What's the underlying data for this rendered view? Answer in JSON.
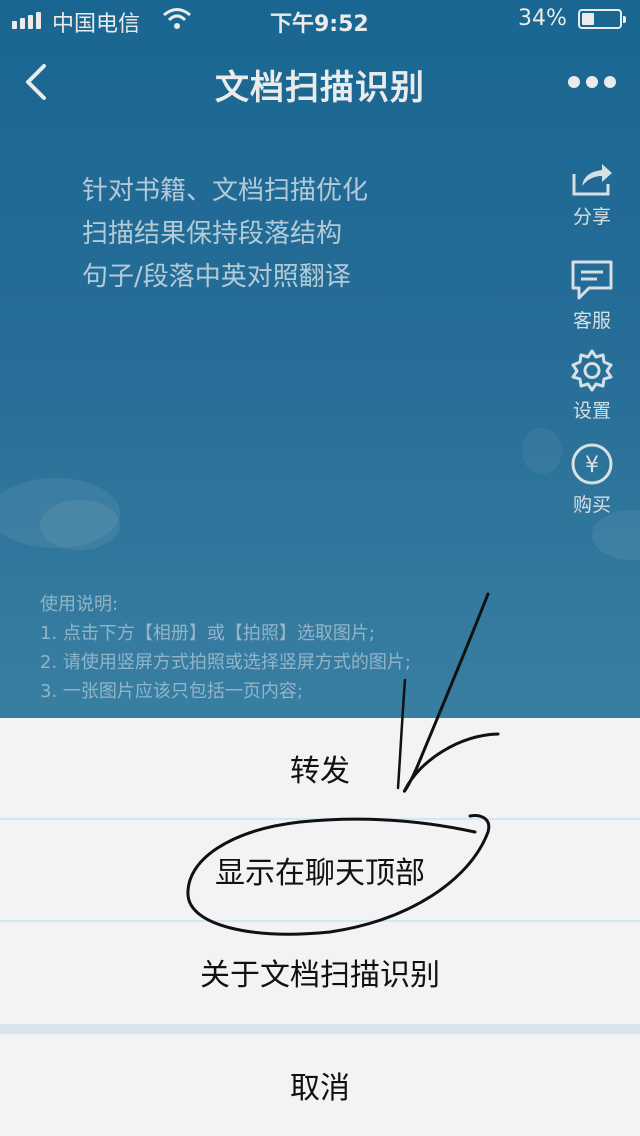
{
  "status_bar": {
    "carrier": "中国电信",
    "time": "下午9:52",
    "battery_percent": "34%",
    "battery_level": 0.34
  },
  "navbar": {
    "title": "文档扫描识别",
    "back_icon": "chevron-left-icon",
    "more_icon": "more-dots-icon"
  },
  "features": [
    "针对书籍、文档扫描优化",
    "扫描结果保持段落结构",
    "句子/段落中英对照翻译"
  ],
  "side_actions": [
    {
      "label": "分享",
      "icon": "share-icon"
    },
    {
      "label": "客服",
      "icon": "chat-icon"
    },
    {
      "label": "设置",
      "icon": "gear-icon"
    },
    {
      "label": "购买",
      "icon": "yen-icon"
    }
  ],
  "instructions": {
    "title": "使用说明:",
    "items": [
      "1. 点击下方【相册】或【拍照】选取图片;",
      "2. 请使用竖屏方式拍照或选择竖屏方式的图片;",
      "3. 一张图片应该只包括一页内容;"
    ]
  },
  "action_sheet": {
    "options": [
      "转发",
      "显示在聊天顶部",
      "关于文档扫描识别"
    ],
    "cancel": "取消"
  },
  "colors": {
    "background": "#1b6f9e",
    "sheet": "#f3f3f5",
    "separator": "#d4e6f2"
  }
}
